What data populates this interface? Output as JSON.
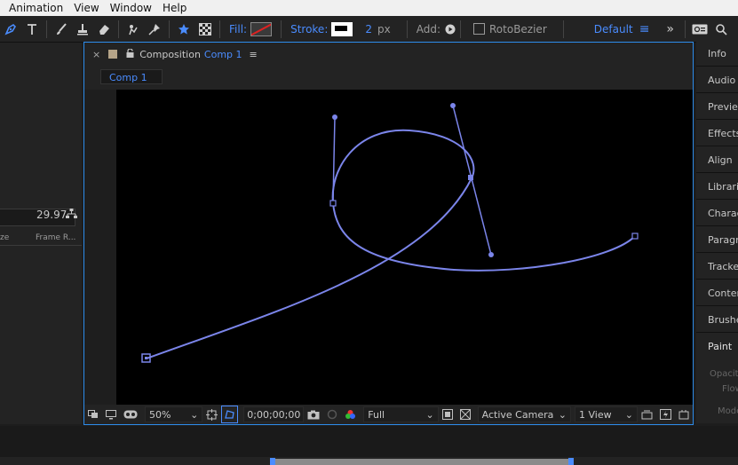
{
  "menu": [
    "Animation",
    "View",
    "Window",
    "Help"
  ],
  "toolbar": {
    "fill_label": "Fill:",
    "stroke_label": "Stroke:",
    "stroke_width": "2",
    "stroke_unit": "px",
    "add_label": "Add:",
    "rotobezier_label": "RotoBezier",
    "workspace": "Default",
    "colors": {
      "accent": "#4a8cff",
      "fill_red": "#dd2222"
    }
  },
  "project": {
    "col_size": "ze",
    "col_frame_rate": "Frame R...",
    "frame_rate_value": "29.97"
  },
  "composition": {
    "title_prefix": "Composition",
    "title_name": "Comp 1",
    "tab_label": "Comp 1",
    "zoom": "50%",
    "timecode": "0;00;00;00",
    "resolution": "Full",
    "camera": "Active Camera",
    "views": "1 View",
    "path_color": "#7b85ea"
  },
  "right_panels": [
    "Info",
    "Audio",
    "Preview",
    "Effects",
    "Align",
    "Libraries",
    "Character",
    "Paragraph",
    "Tracker",
    "Content",
    "Brushes",
    "Paint",
    "Opacity",
    "Flow",
    "Mode"
  ]
}
